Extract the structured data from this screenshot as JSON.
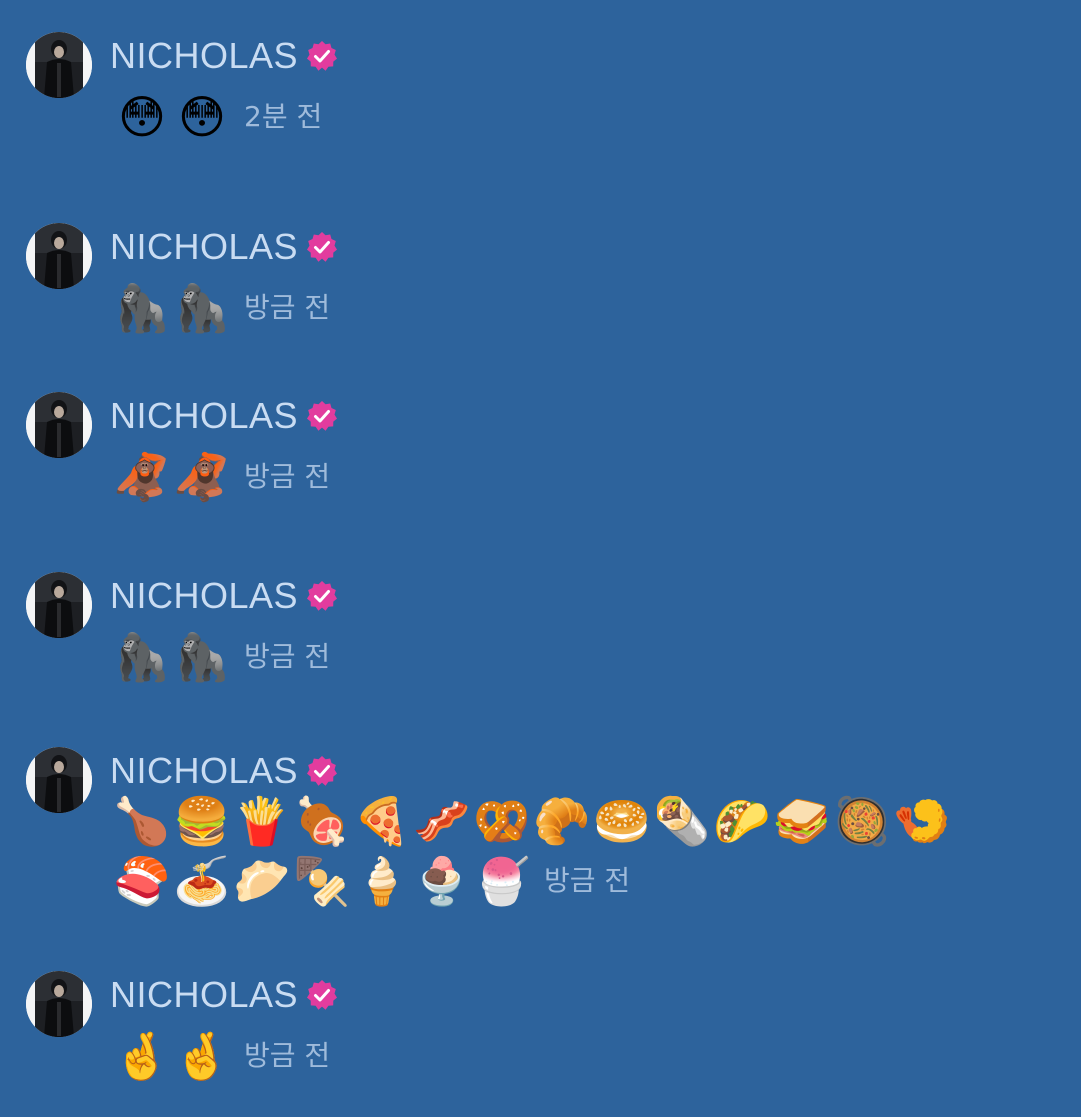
{
  "messages": [
    {
      "username": "NICHOLAS",
      "emojis": [
        "😳",
        "😳"
      ],
      "timestamp": "2분 전"
    },
    {
      "username": "NICHOLAS",
      "emojis": [
        "🦍",
        "🦍"
      ],
      "timestamp": "방금 전"
    },
    {
      "username": "NICHOLAS",
      "emojis": [
        "🦧",
        "🦧"
      ],
      "timestamp": "방금 전"
    },
    {
      "username": "NICHOLAS",
      "emojis": [
        "🦍",
        "🦍"
      ],
      "timestamp": "방금 전"
    },
    {
      "username": "NICHOLAS",
      "emojis": [
        "🍗",
        "🍔",
        "🍟",
        "🍖",
        "🍕",
        "🥓",
        "🥨",
        "🥐",
        "🥯",
        "🌯",
        "🌮",
        "🥪",
        "🥘",
        "🍤",
        "🍣",
        "🍝",
        "🥟",
        "🍢",
        "🍦",
        "🍨",
        "🍧"
      ],
      "timestamp": "방금 전"
    },
    {
      "username": "NICHOLAS",
      "emojis": [
        "🤞",
        "🤞"
      ],
      "timestamp": "방금 전"
    }
  ],
  "icons": {
    "verified_badge": "verified-badge-icon",
    "avatar": "profile-avatar"
  },
  "colors": {
    "background": "#2d639c",
    "username": "#c9dcf2",
    "timestamp": "#9fbbdb",
    "verified_badge": "#e23c9e"
  }
}
